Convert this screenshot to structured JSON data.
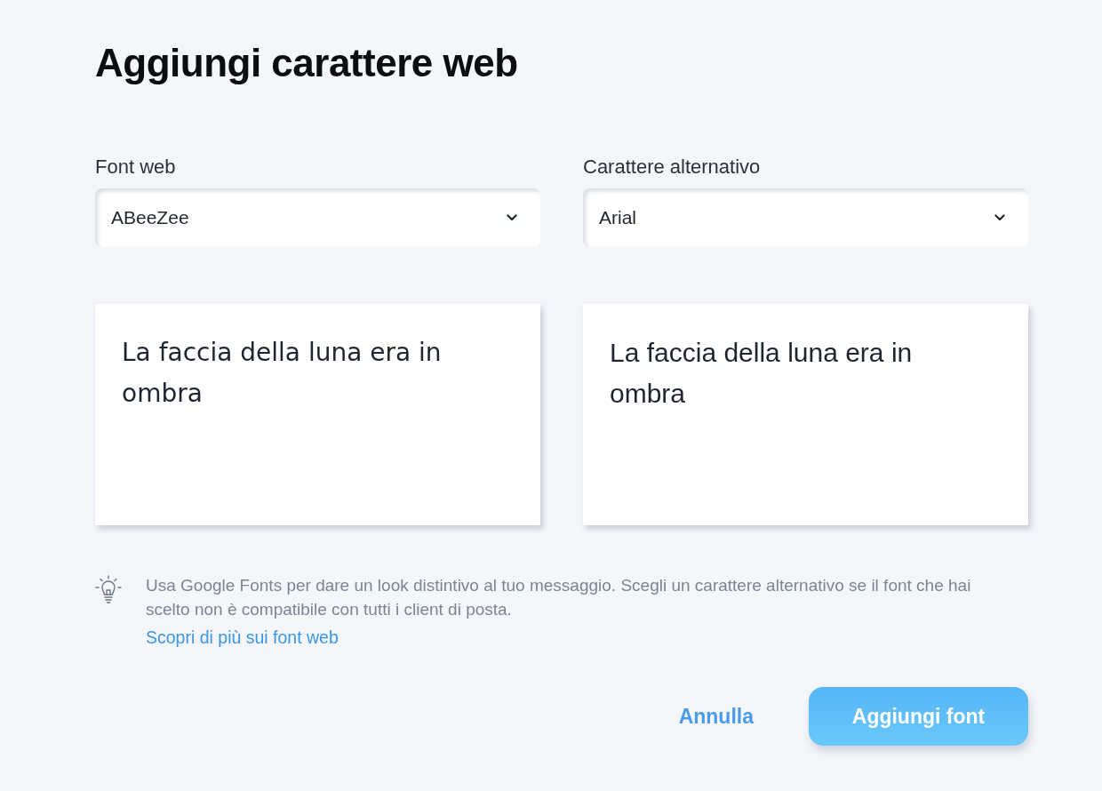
{
  "title": "Aggiungi carattere web",
  "columns": [
    {
      "label": "Font web",
      "value": "ABeeZee",
      "preview": {
        "kind": "webfont",
        "text": "La faccia della luna era in ombra"
      }
    },
    {
      "label": "Carattere alternativo",
      "value": "Arial",
      "preview": {
        "kind": "fallback",
        "text": "La faccia della luna era in ombra"
      }
    }
  ],
  "hint": {
    "text": "Usa Google Fonts per dare un look distintivo al tuo messaggio. Scegli un carattere alternativo se il font che hai scelto non è compatibile con tutti i client di posta.",
    "link": "Scopri di più sui font web"
  },
  "buttons": [
    {
      "kind": "secondary",
      "label": "Annulla"
    },
    {
      "kind": "primary",
      "label": "Aggiungi font"
    }
  ]
}
